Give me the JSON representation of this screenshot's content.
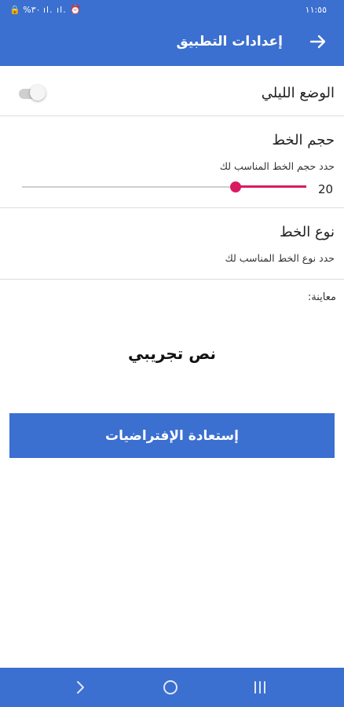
{
  "status_bar": {
    "left_text": "🔒 %٣٠ ıl. ıl. ⏰",
    "time": "١١:٥٥"
  },
  "app_bar": {
    "title": "إعدادات التطبيق",
    "back_icon": "arrow-right-icon"
  },
  "settings": {
    "night_mode": {
      "label": "الوضع الليلي",
      "enabled": false
    },
    "font_size": {
      "title": "حجم الخط",
      "subtitle": "حدد حجم الخط المناسب لك",
      "value": "20",
      "slider_fraction": 0.25
    },
    "font_type": {
      "title": "نوع الخط",
      "subtitle": "حدد نوع الخط المناسب لك"
    }
  },
  "preview": {
    "label": "معاينة:",
    "sample_text": "نص تجريبي"
  },
  "reset_button": {
    "label": "إستعادة الإفتراضيات"
  },
  "colors": {
    "primary": "#3b6fd0",
    "accent": "#d81b60"
  },
  "nav_bar": {
    "back_icon": "chevron-right-icon",
    "home_icon": "home-circle-icon",
    "recents_icon": "recents-icon"
  }
}
